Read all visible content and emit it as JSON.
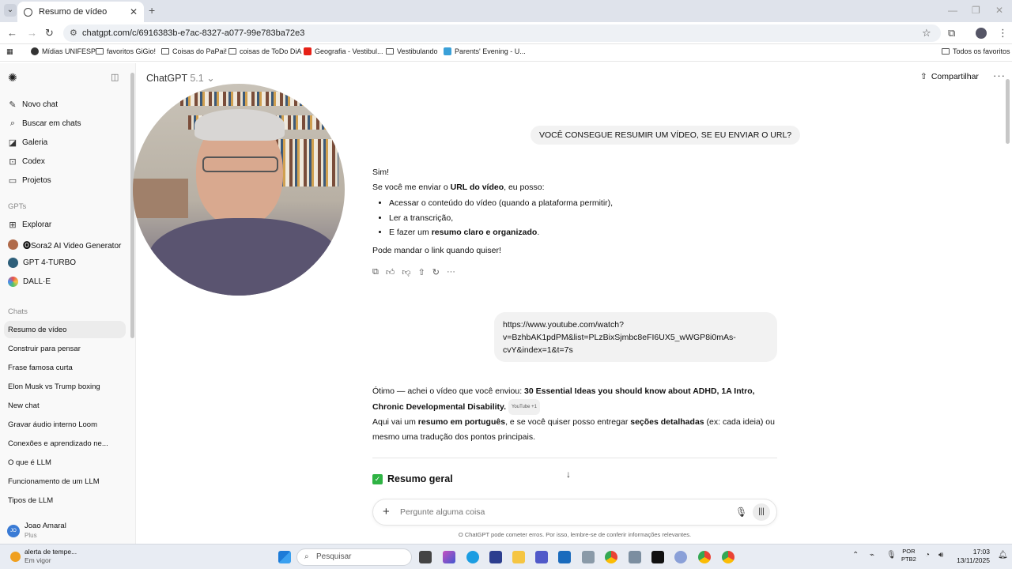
{
  "browser": {
    "tab_title": "Resumo de vídeo",
    "url": "chatgpt.com/c/6916383b-e7ac-8327-a077-99e783ba72e3",
    "bookmarks": [
      "Mídias UNIFESP",
      "favoritos GiGio!",
      "Coisas do PaPai!",
      "coisas de ToDo DiA",
      "Geografia - Vestibul...",
      "Vestibulando",
      "Parents' Evening - U..."
    ],
    "all_bookmarks": "Todos os favoritos"
  },
  "sidebar": {
    "nav": [
      {
        "label": "Novo chat",
        "icon": "edit-icon"
      },
      {
        "label": "Buscar em chats",
        "icon": "search-icon"
      },
      {
        "label": "Galeria",
        "icon": "image-icon"
      },
      {
        "label": "Codex",
        "icon": "code-icon"
      },
      {
        "label": "Projetos",
        "icon": "folder-icon"
      }
    ],
    "gpts_heading": "GPTs",
    "gpts": [
      {
        "label": "Explorar"
      },
      {
        "label": "🅞Sora2 AI Video Generator"
      },
      {
        "label": "GPT 4-TURBO"
      },
      {
        "label": "DALL·E"
      }
    ],
    "chats_heading": "Chats",
    "chats": [
      "Resumo de vídeo",
      "Construir para pensar",
      "Frase famosa curta",
      "Elon Musk vs Trump boxing",
      "New chat",
      "Gravar áudio interno Loom",
      "Conexões e aprendizado ne...",
      "O que é LLM",
      "Funcionamento de um LLM",
      "Tipos de LLM"
    ],
    "user_name": "Joao Amaral",
    "user_plan": "Plus",
    "user_initials": "JO"
  },
  "header": {
    "model_name": "ChatGPT",
    "model_version": "5.1",
    "share_label": "Compartilhar"
  },
  "conversation": {
    "user_msg_1": "VOCÊ CONSEGUE RESUMIR UM VÍDEO, SE EU ENVIAR O URL?",
    "reply_1_line1": "Sim!",
    "reply_1_line2_pre": "Se você me enviar o ",
    "reply_1_line2_bold": "URL do vídeo",
    "reply_1_line2_post": ", eu posso:",
    "reply_1_bullet1": "Acessar o conteúdo do vídeo (quando a plataforma permitir),",
    "reply_1_bullet2": "Ler a transcrição,",
    "reply_1_bullet3_pre": "E fazer um ",
    "reply_1_bullet3_bold": "resumo claro e organizado",
    "reply_1_bullet3_post": ".",
    "reply_1_end": "Pode mandar o link quando quiser!",
    "user_msg_2_line1": "https://www.youtube.com/watch?",
    "user_msg_2_line2": "v=BzhbAK1pdPM&list=PLzBixSjmbc8eFI6UX5_wWGP8i0mAs-",
    "user_msg_2_line3": "cvY&index=1&t=7s",
    "reply_2_pre": "Ótimo — achei o vídeo que você enviou: ",
    "reply_2_bold_title": "30 Essential Ideas you should know about ADHD, 1A Intro, Chronic Developmental Disability.",
    "reply_2_source": "YouTube +1",
    "reply_2_line3_pre": "Aqui vai um ",
    "reply_2_line3_bold1": "resumo em português",
    "reply_2_line3_mid": ", e se você quiser posso entregar ",
    "reply_2_line3_bold2": "seções detalhadas",
    "reply_2_line3_post": " (ex: cada ideia) ou",
    "reply_2_line4": "mesmo uma tradução dos pontos principais.",
    "section_heading": "Resumo geral"
  },
  "composer": {
    "placeholder": "Pergunte alguma coisa",
    "disclaimer": "O ChatGPT pode cometer erros. Por isso, lembre-se de conferir informações relevantes."
  },
  "taskbar": {
    "weather_title": "alerta de tempe...",
    "weather_sub": "Em vigor",
    "search_label": "Pesquisar",
    "lang_line1": "POR",
    "lang_line2": "PTB2",
    "time": "17:03",
    "date": "13/11/2025"
  }
}
